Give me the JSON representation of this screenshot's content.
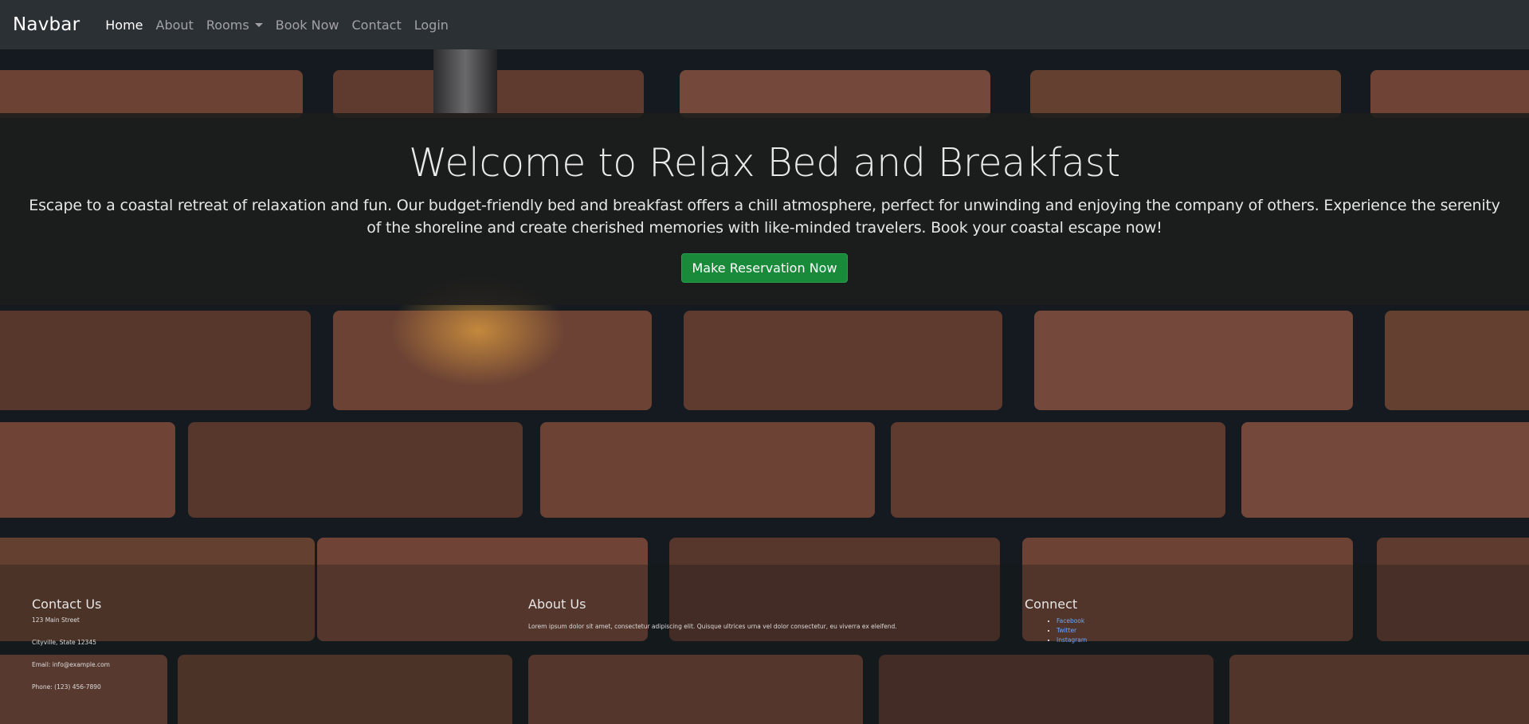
{
  "navbar": {
    "brand": "Navbar",
    "items": [
      {
        "label": "Home"
      },
      {
        "label": "About"
      },
      {
        "label": "Rooms"
      },
      {
        "label": "Book Now"
      },
      {
        "label": "Contact"
      },
      {
        "label": "Login"
      }
    ]
  },
  "hero": {
    "title": "Welcome to Relax Bed and Breakfast",
    "text": "Escape to a coastal retreat of relaxation and fun. Our budget-friendly bed and breakfast offers a chill atmosphere, perfect for unwinding and enjoying the company of others. Experience the serenity of the shoreline and create cherished memories with like-minded travelers. Book your coastal escape now!",
    "button": "Make Reservation Now"
  },
  "footer": {
    "contact": {
      "heading": "Contact Us",
      "lines": [
        "123 Main Street",
        "Cityville, State 12345",
        "Email: info@example.com",
        "Phone: (123) 456-7890"
      ]
    },
    "about": {
      "heading": "About Us",
      "text": "Lorem ipsum dolor sit amet, consectetur adipiscing elit. Quisque ultrices urna vel dolor consectetur, eu viverra ex eleifend."
    },
    "connect": {
      "heading": "Connect",
      "links": [
        "Facebook",
        "Twitter",
        "Instagram"
      ]
    }
  },
  "colors": {
    "navbar_bg": "#2b3035",
    "button_bg": "#198a3a",
    "link": "#6aa6ff",
    "brick": "#6e4436"
  }
}
